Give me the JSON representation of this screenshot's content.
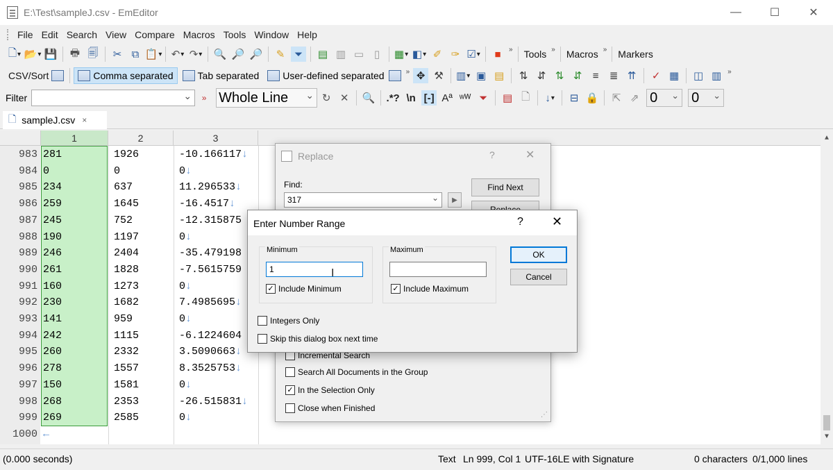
{
  "window": {
    "title": "E:\\Test\\sampleJ.csv - EmEditor",
    "minimize": "—",
    "maximize": "☐",
    "close": "✕"
  },
  "menu": [
    "File",
    "Edit",
    "Search",
    "View",
    "Compare",
    "Macros",
    "Tools",
    "Window",
    "Help"
  ],
  "toolbar1": {
    "tools_label": "Tools",
    "macros_label": "Macros",
    "markers_label": "Markers"
  },
  "toolbar2": {
    "csv_sort": "CSV/Sort",
    "comma": "Comma separated",
    "tab": "Tab separated",
    "user": "User-defined separated"
  },
  "filterbar": {
    "label": "Filter",
    "value": "",
    "scope": "Whole Line",
    "num1": "0",
    "num2": "0"
  },
  "doc_tab": {
    "name": "sampleJ.csv",
    "close": "×"
  },
  "columns": [
    "1",
    "2",
    "3"
  ],
  "rows": [
    {
      "n": "983",
      "c1": "281",
      "c2": "1926",
      "c3": "-10.166117↓"
    },
    {
      "n": "984",
      "c1": "0",
      "c2": "0",
      "c3": "0↓"
    },
    {
      "n": "985",
      "c1": "234",
      "c2": "637",
      "c3": "11.296533↓"
    },
    {
      "n": "986",
      "c1": "259",
      "c2": "1645",
      "c3": "-16.4517↓"
    },
    {
      "n": "987",
      "c1": "245",
      "c2": "752",
      "c3": "-12.315875"
    },
    {
      "n": "988",
      "c1": "190",
      "c2": "1197",
      "c3": "0↓"
    },
    {
      "n": "989",
      "c1": "246",
      "c2": "2404",
      "c3": "-35.479198"
    },
    {
      "n": "990",
      "c1": "261",
      "c2": "1828",
      "c3": "-7.5615759"
    },
    {
      "n": "991",
      "c1": "160",
      "c2": "1273",
      "c3": "0↓"
    },
    {
      "n": "992",
      "c1": "230",
      "c2": "1682",
      "c3": "7.4985695↓"
    },
    {
      "n": "993",
      "c1": "141",
      "c2": "959",
      "c3": "0↓"
    },
    {
      "n": "994",
      "c1": "242",
      "c2": "1115",
      "c3": "-6.1224604"
    },
    {
      "n": "995",
      "c1": "260",
      "c2": "2332",
      "c3": "3.5090663↓"
    },
    {
      "n": "996",
      "c1": "278",
      "c2": "1557",
      "c3": "8.3525753↓"
    },
    {
      "n": "997",
      "c1": "150",
      "c2": "1581",
      "c3": "0↓"
    },
    {
      "n": "998",
      "c1": "268",
      "c2": "2353",
      "c3": "-26.515831↓"
    },
    {
      "n": "999",
      "c1": "269",
      "c2": "2585",
      "c3": "0↓"
    },
    {
      "n": "1000",
      "c1": "←",
      "c2": "",
      "c3": ""
    }
  ],
  "replace_dialog": {
    "title": "Replace",
    "help": "?",
    "close": "✕",
    "find_label": "Find:",
    "find_value": "317",
    "find_next": "Find Next",
    "replace_btn": "Replace",
    "incremental": "Incremental Search",
    "search_all": "Search All Documents in the Group",
    "in_selection": "In the Selection Only",
    "close_when": "Close when Finished"
  },
  "number_range_dialog": {
    "title": "Enter Number Range",
    "help": "?",
    "close": "✕",
    "min_label": "Minimum",
    "max_label": "Maximum",
    "min_value": "1",
    "max_value": "",
    "include_min": "Include Minimum",
    "include_max": "Include Maximum",
    "integers_only": "Integers Only",
    "skip_dialog": "Skip this dialog box next time",
    "ok": "OK",
    "cancel": "Cancel"
  },
  "status": {
    "time": "(0.000 seconds)",
    "mode": "Text",
    "position": "Ln 999, Col 1",
    "encoding": "UTF-16LE with Signature",
    "chars": "0 characters",
    "lines": "0/1,000 lines"
  },
  "colors": {
    "selection": "#c8f0c8",
    "selection_border": "#3a9a3a",
    "eol_marker": "#6a9ad6",
    "accent": "#0078d7"
  }
}
